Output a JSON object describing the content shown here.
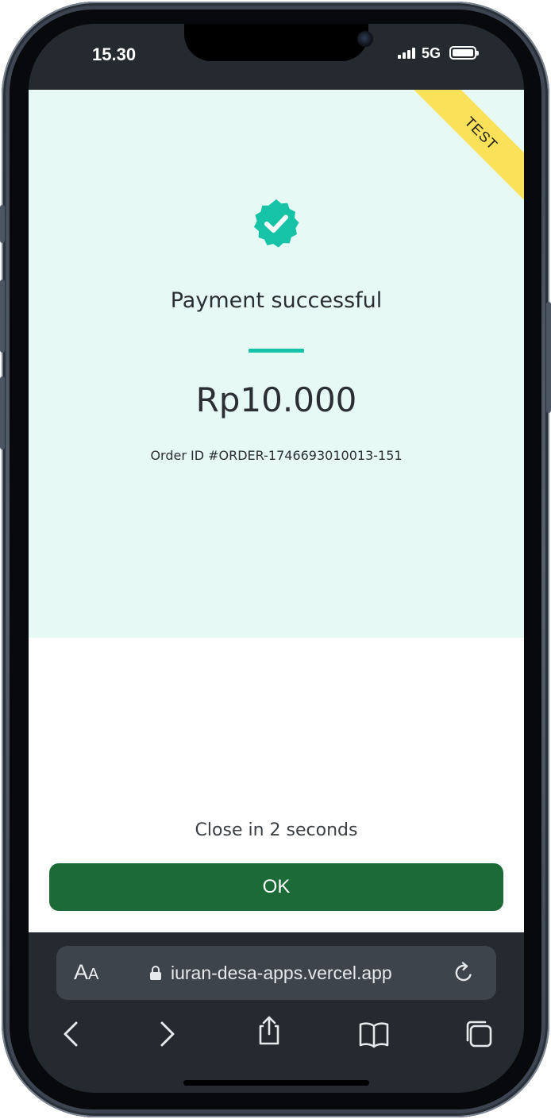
{
  "status_bar": {
    "time": "15.30",
    "network": "5G"
  },
  "ribbon": {
    "label": "TEST",
    "color": "#fbe05a"
  },
  "payment": {
    "icon": "check-badge-icon",
    "title": "Payment successful",
    "amount": "Rp10.000",
    "order_id": "Order ID #ORDER-1746693010013-151"
  },
  "footer": {
    "countdown": "Close in 2 seconds",
    "ok_label": "OK"
  },
  "browser": {
    "text_size_large": "A",
    "text_size_small": "A",
    "url": "iuran-desa-apps.vercel.app",
    "toolbar": [
      "back-icon",
      "forward-icon",
      "share-icon",
      "bookmarks-icon",
      "tabs-icon"
    ]
  },
  "colors": {
    "success_panel": "#e6f9f4",
    "accent_teal": "#17c3a6",
    "primary_button": "#1c6a37"
  }
}
